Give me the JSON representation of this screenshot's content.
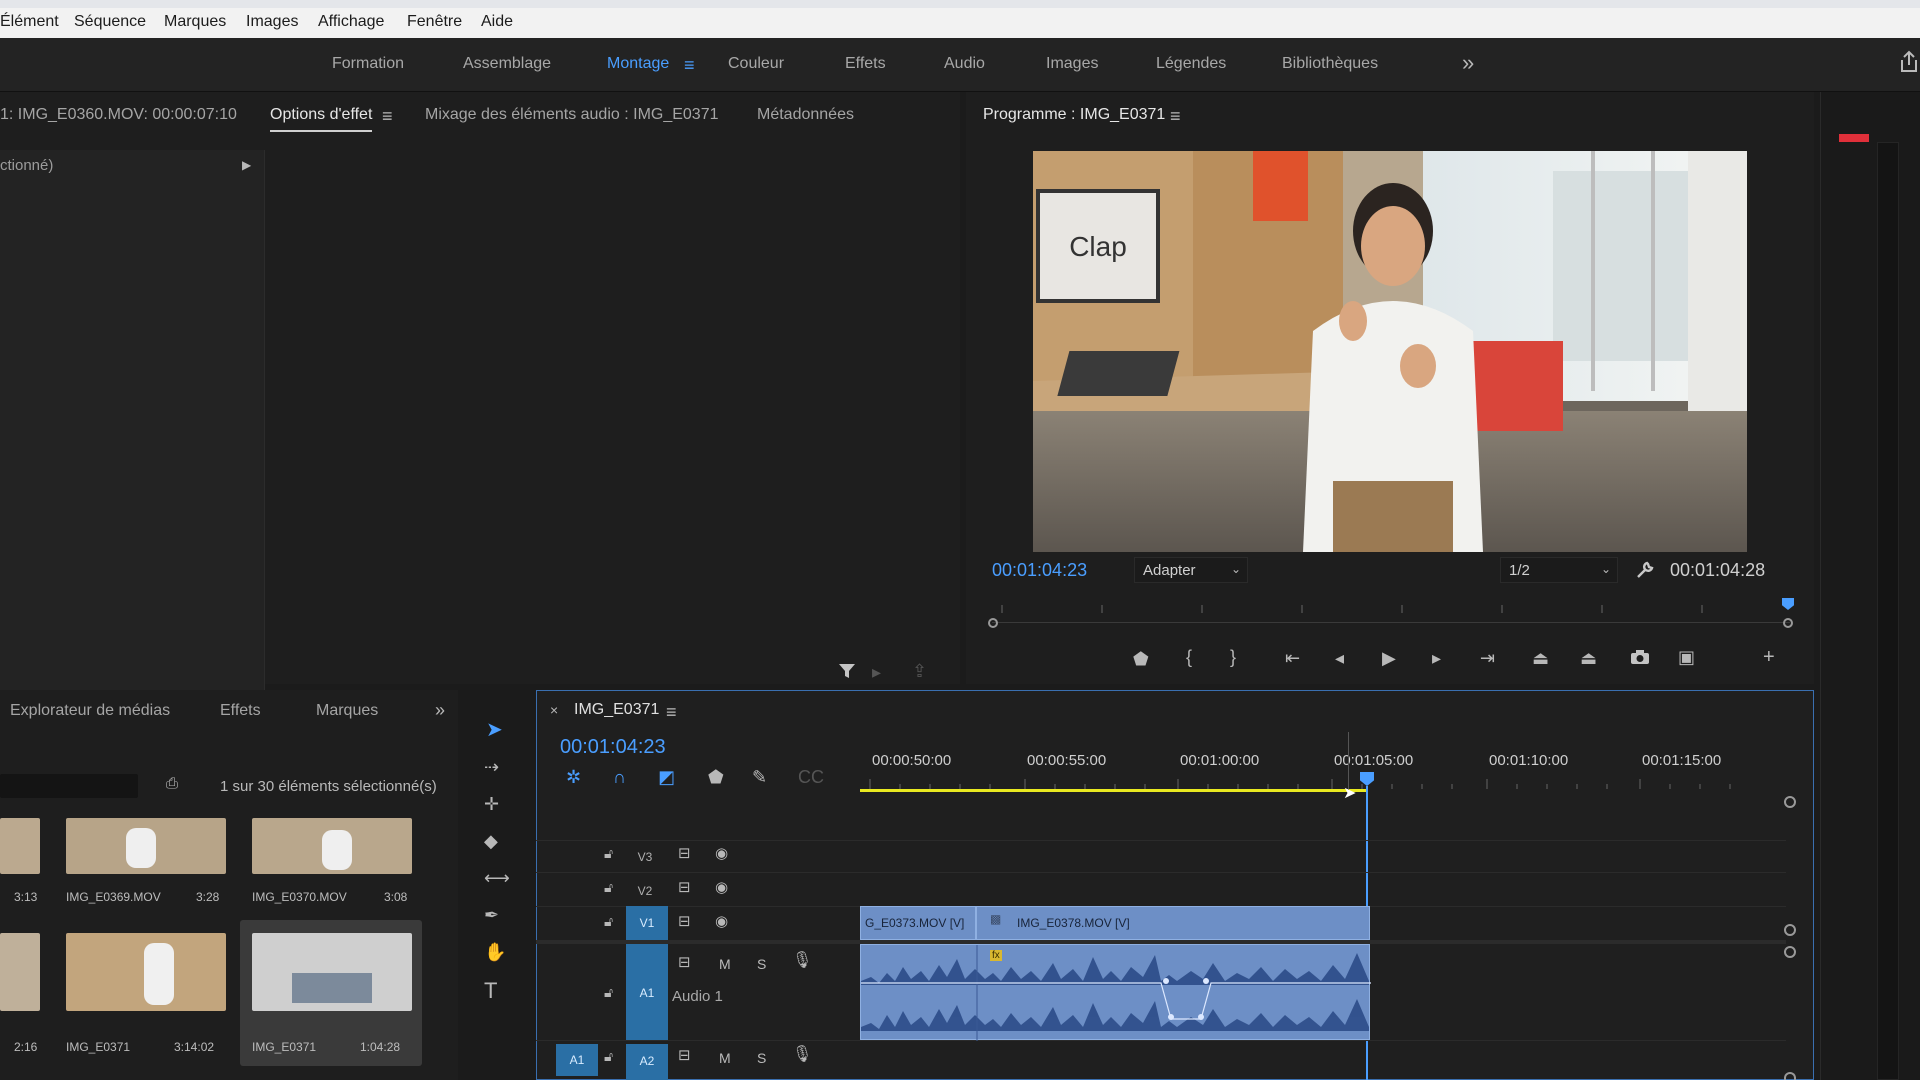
{
  "menu": [
    "Élément",
    "Séquence",
    "Marques",
    "Images",
    "Affichage",
    "Fenêtre",
    "Aide"
  ],
  "workspaces": {
    "items": [
      "Formation",
      "Assemblage",
      "Montage",
      "Couleur",
      "Effets",
      "Audio",
      "Images",
      "Légendes",
      "Bibliothèques"
    ],
    "active": "Montage",
    "more_glyph": "»"
  },
  "source_panel": {
    "tab_source": "1: IMG_E0360.MOV: 00:00:07:10",
    "tab_effect_options": "Options d'effet",
    "tab_audio_mixer": "Mixage des éléments audio : IMG_E0371",
    "tab_metadata": "Métadonnées",
    "no_clip_text": "ctionné)"
  },
  "program_monitor": {
    "title": "Programme : IMG_E0371",
    "current_time": "00:01:04:23",
    "fit_option": "Adapter",
    "resolution": "1/2",
    "duration": "00:01:04:28",
    "video_sign": "Clap"
  },
  "project_panel": {
    "tabs": [
      "Explorateur de médias",
      "Effets",
      "Marques"
    ],
    "selection_status": "1 sur 30 éléments sélectionné(s)",
    "items": [
      {
        "name": "",
        "duration": "3:13"
      },
      {
        "name": "IMG_E0369.MOV",
        "duration": "3:28"
      },
      {
        "name": "IMG_E0370.MOV",
        "duration": "3:08"
      },
      {
        "name": "",
        "duration": "2:16"
      },
      {
        "name": "IMG_E0371",
        "duration": "3:14:02"
      },
      {
        "name": "IMG_E0371",
        "duration": "1:04:28"
      }
    ]
  },
  "timeline": {
    "sequence_name": "IMG_E0371",
    "timecode": "00:01:04:23",
    "ruler": [
      "00:00:50:00",
      "00:00:55:00",
      "00:01:00:00",
      "00:01:05:00",
      "00:01:10:00",
      "00:01:15:00"
    ],
    "tracks": {
      "v3": "V3",
      "v2": "V2",
      "v1": "V1",
      "a1": "A1",
      "a1_name": "Audio 1",
      "a2": "A2",
      "src_a1": "A1",
      "mute": "M",
      "solo": "S"
    },
    "clips": {
      "v_clip_1": "G_E0373.MOV [V]",
      "v_clip_2": "IMG_E0378.MOV [V]",
      "fx_badge": "fx"
    }
  },
  "colors": {
    "accent": "#4a9eff",
    "clip_video": "#6d8fc6",
    "clip_audio": "#6d8fc6",
    "track_active": "#2a6fa5",
    "work_area": "#e9e920"
  }
}
